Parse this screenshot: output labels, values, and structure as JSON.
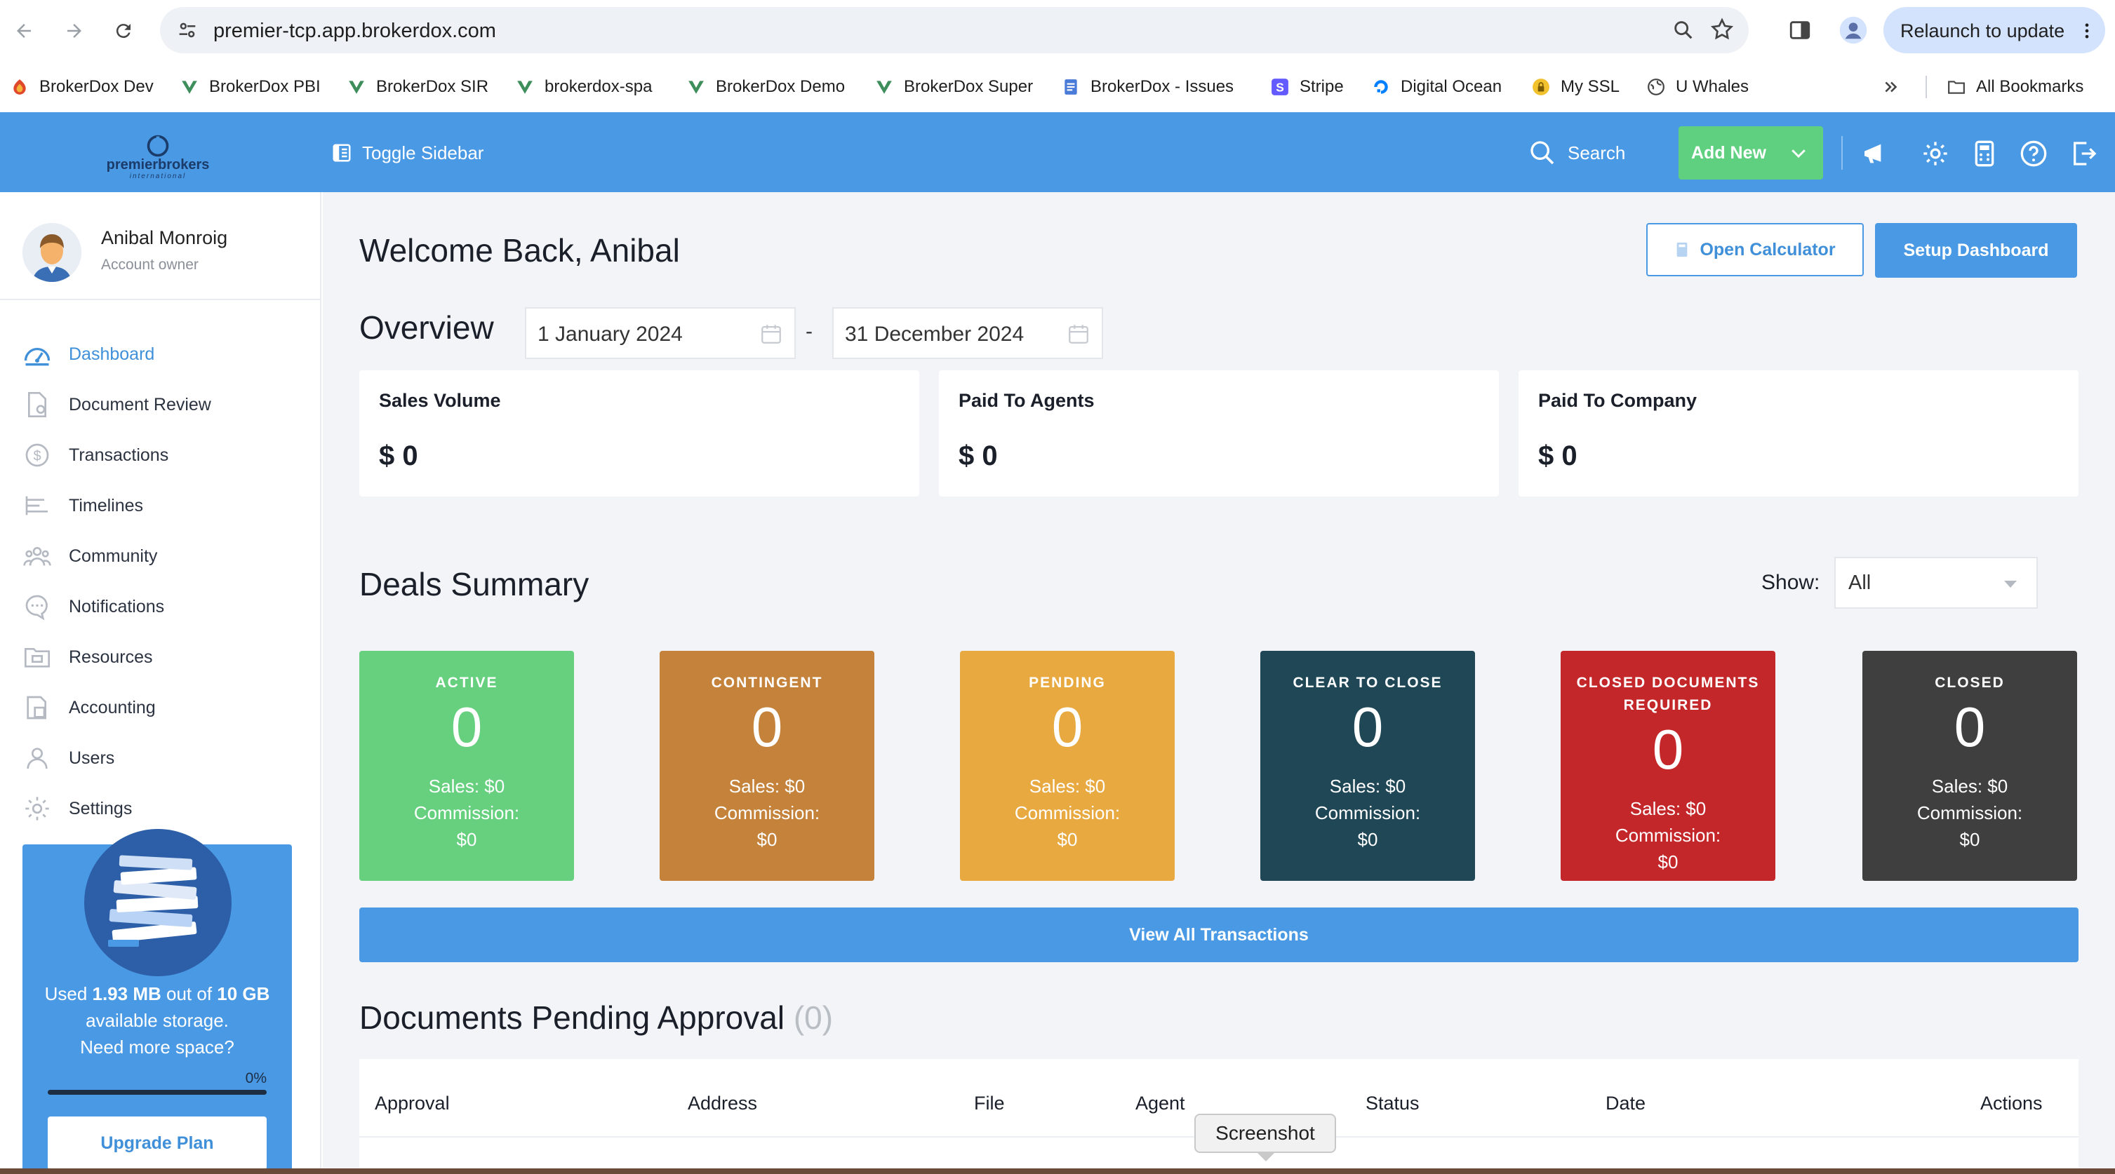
{
  "browser": {
    "url": "premier-tcp.app.brokerdox.com",
    "relaunch_label": "Relaunch to update",
    "bookmarks": [
      {
        "label": "BrokerDox Dev",
        "icon": "brokerdox-red-icon"
      },
      {
        "label": "BrokerDox PBI",
        "icon": "brokerdox-v-icon"
      },
      {
        "label": "BrokerDox SIR",
        "icon": "brokerdox-v-icon"
      },
      {
        "label": "brokerdox-spa",
        "icon": "brokerdox-v-icon"
      },
      {
        "label": "BrokerDox Demo",
        "icon": "brokerdox-v-icon"
      },
      {
        "label": "BrokerDox Super",
        "icon": "brokerdox-v-icon"
      },
      {
        "label": "BrokerDox - Issues",
        "icon": "doc-icon"
      },
      {
        "label": "Stripe",
        "icon": "stripe-icon"
      },
      {
        "label": "Digital Ocean",
        "icon": "digital-ocean-icon"
      },
      {
        "label": "My SSL",
        "icon": "lock-icon"
      },
      {
        "label": "U Whales",
        "icon": "globe-icon"
      }
    ],
    "all_bookmarks": "All Bookmarks"
  },
  "header": {
    "logo_text": "premierbrokers",
    "logo_sub": "international",
    "toggle_sidebar": "Toggle Sidebar",
    "search": "Search",
    "add_new": "Add New"
  },
  "profile": {
    "name": "Anibal Monroig",
    "role": "Account owner"
  },
  "sidebar": {
    "items": [
      {
        "label": "Dashboard",
        "icon": "dashboard-icon",
        "active": true
      },
      {
        "label": "Document Review",
        "icon": "document-review-icon"
      },
      {
        "label": "Transactions",
        "icon": "dollar-icon"
      },
      {
        "label": "Timelines",
        "icon": "timeline-icon"
      },
      {
        "label": "Community",
        "icon": "community-icon"
      },
      {
        "label": "Notifications",
        "icon": "chat-icon"
      },
      {
        "label": "Resources",
        "icon": "folder-icon"
      },
      {
        "label": "Accounting",
        "icon": "accounting-icon"
      },
      {
        "label": "Users",
        "icon": "user-icon"
      },
      {
        "label": "Settings",
        "icon": "gear-icon"
      }
    ]
  },
  "storage": {
    "used_prefix": "Used ",
    "used": "1.93 MB",
    "out_of": " out of ",
    "total": "10 GB",
    "suffix": " available storage.",
    "need_more": "Need more space?",
    "percent_label": "0%",
    "percent": 0,
    "upgrade": "Upgrade Plan"
  },
  "main": {
    "welcome": "Welcome Back, Anibal",
    "open_calculator": "Open Calculator",
    "setup_dashboard": "Setup Dashboard",
    "overview": "Overview",
    "date_from": "1 January 2024",
    "date_sep": "-",
    "date_to": "31 December 2024",
    "stats": [
      {
        "label": "Sales Volume",
        "value": "$ 0"
      },
      {
        "label": "Paid To Agents",
        "value": "$ 0"
      },
      {
        "label": "Paid To Company",
        "value": "$ 0"
      }
    ],
    "deals_title": "Deals Summary",
    "show_label": "Show:",
    "show_value": "All",
    "deals": [
      {
        "title": "ACTIVE",
        "count": "0",
        "sales": "Sales: $0",
        "commission": "Commission:",
        "commission_value": "$0",
        "color": "#66d07f"
      },
      {
        "title": "CONTINGENT",
        "count": "0",
        "sales": "Sales: $0",
        "commission": "Commission:",
        "commission_value": "$0",
        "color": "#c4823a"
      },
      {
        "title": "PENDING",
        "count": "0",
        "sales": "Sales: $0",
        "commission": "Commission:",
        "commission_value": "$0",
        "color": "#e8a941"
      },
      {
        "title": "CLEAR TO CLOSE",
        "count": "0",
        "sales": "Sales: $0",
        "commission": "Commission:",
        "commission_value": "$0",
        "color": "#1f4756"
      },
      {
        "title": "CLOSED DOCUMENTS REQUIRED",
        "count": "0",
        "sales": "Sales: $0",
        "commission": "Commission:",
        "commission_value": "$0",
        "color": "#c4272a"
      },
      {
        "title": "CLOSED",
        "count": "0",
        "sales": "Sales: $0",
        "commission": "Commission:",
        "commission_value": "$0",
        "color": "#3f3f3f"
      }
    ],
    "view_all": "View All Transactions",
    "docs_title": "Documents Pending Approval",
    "docs_count": "(0)",
    "docs_columns": [
      "Approval",
      "Address",
      "File",
      "Agent",
      "Status",
      "Date",
      "Actions"
    ]
  },
  "tooltip": "Screenshot",
  "colors": {
    "brand_blue": "#4a99e4",
    "add_new_green": "#5fcf80"
  }
}
